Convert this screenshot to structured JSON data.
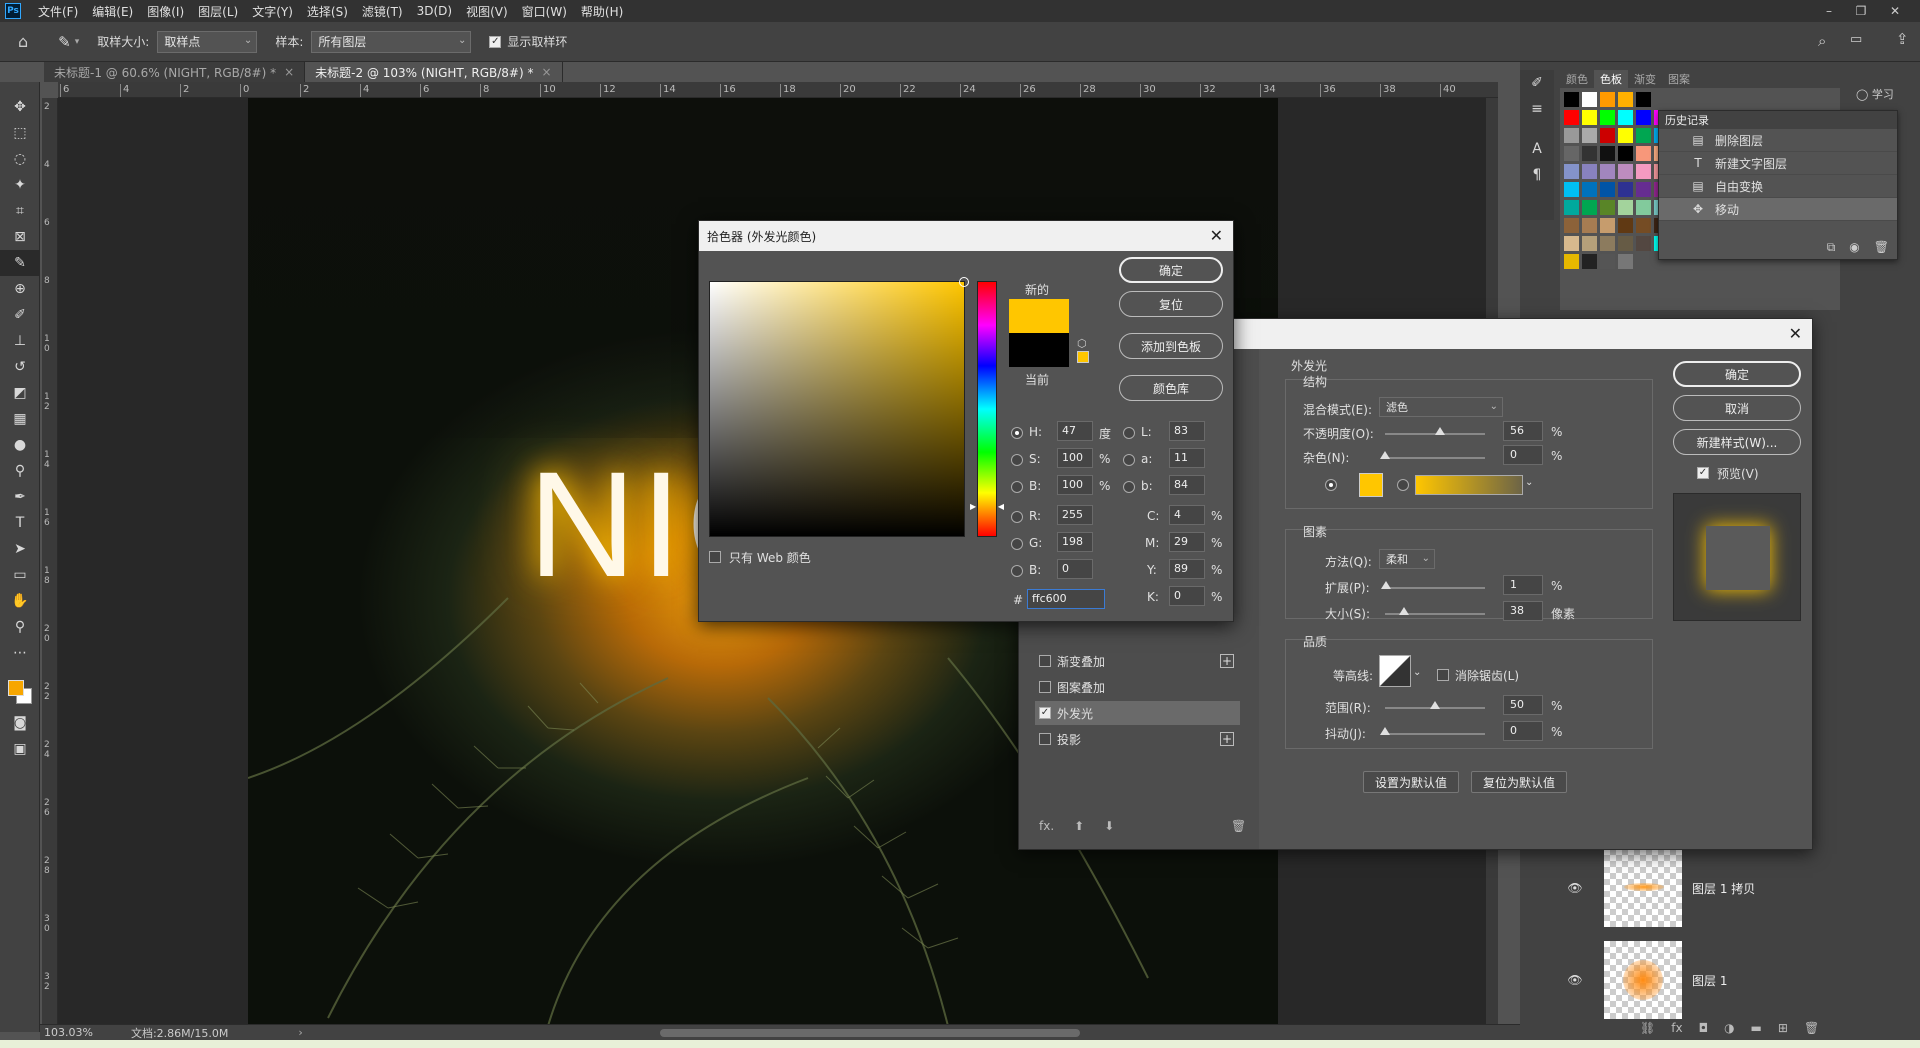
{
  "menubar": {
    "logo": "Ps",
    "items": [
      "文件(F)",
      "编辑(E)",
      "图像(I)",
      "图层(L)",
      "文字(Y)",
      "选择(S)",
      "滤镜(T)",
      "3D(D)",
      "视图(V)",
      "窗口(W)",
      "帮助(H)"
    ],
    "minimize": "–",
    "restore": "❐",
    "close": "✕"
  },
  "options": {
    "sample_size_label": "取样大小:",
    "sample_size_value": "取样点",
    "sample_label": "样本:",
    "sample_value": "所有图层",
    "show_ring_label": "显示取样环",
    "show_ring_checked": true
  },
  "tabs": [
    {
      "label": "未标题-1 @ 60.6% (NIGHT, RGB/8#) *",
      "close": "×"
    },
    {
      "label": "未标题-2 @ 103% (NIGHT, RGB/8#) *",
      "close": "×"
    }
  ],
  "ruler": {
    "h_ticks": [
      "6",
      "4",
      "2",
      "0",
      "2",
      "4",
      "6",
      "8",
      "10",
      "12",
      "14",
      "16",
      "18",
      "20",
      "22",
      "24",
      "26",
      "28",
      "30",
      "32",
      "34",
      "36",
      "38",
      "40",
      "42"
    ],
    "v_ticks": [
      "2",
      "4",
      "6",
      "8",
      "1 0",
      "1 2",
      "1 4",
      "1 6",
      "1 8",
      "2 0",
      "2 2",
      "2 4",
      "2 6",
      "2 8",
      "3 0",
      "3 2"
    ]
  },
  "canvas": {
    "text": "NIG"
  },
  "status": {
    "zoom": "103.03%",
    "doc": "文档:2.86M/15.0M"
  },
  "swatches_panel": {
    "tabs": [
      "颜色",
      "色板",
      "渐变",
      "图案"
    ],
    "active_tab": "色板",
    "learn_label": "学习"
  },
  "history": {
    "title": "历史记录",
    "items": [
      {
        "icon": "▤",
        "label": "删除图层"
      },
      {
        "icon": "T",
        "label": "新建文字图层"
      },
      {
        "icon": "▤",
        "label": "自由变换"
      },
      {
        "icon": "✥",
        "label": "移动"
      }
    ]
  },
  "layers": [
    {
      "name": "图层 1 拷贝"
    },
    {
      "name": "图层 1"
    }
  ],
  "layer_style": {
    "left_items": [
      {
        "label": "渐变叠加",
        "checked": false,
        "plus": "+"
      },
      {
        "label": "图案叠加",
        "checked": false
      },
      {
        "label": "外发光",
        "checked": true,
        "selected": true
      },
      {
        "label": "投影",
        "checked": false,
        "plus": "+"
      }
    ],
    "fx_label": "fx.",
    "section_title": "外发光",
    "structure_title": "结构",
    "blend_mode_label": "混合模式(E):",
    "blend_mode_value": "滤色",
    "opacity_label": "不透明度(O):",
    "opacity_value": "56",
    "noise_label": "杂色(N):",
    "noise_value": "0",
    "percent": "%",
    "elements_title": "图素",
    "technique_label": "方法(Q):",
    "technique_value": "柔和",
    "spread_label": "扩展(P):",
    "spread_value": "1",
    "size_label": "大小(S):",
    "size_value": "38",
    "px_unit": "像素",
    "quality_title": "品质",
    "contour_label": "等高线:",
    "antialias_label": "消除锯齿(L)",
    "range_label": "范围(R):",
    "range_value": "50",
    "jitter_label": "抖动(J):",
    "jitter_value": "0",
    "set_default": "设置为默认值",
    "reset_default": "复位为默认值",
    "ok": "确定",
    "cancel": "取消",
    "new_style": "新建样式(W)...",
    "preview_label": "预览(V)",
    "glow_color": "#ffc600"
  },
  "color_picker": {
    "title": "拾色器 (外发光颜色)",
    "ok": "确定",
    "reset": "复位",
    "add_swatch": "添加到色板",
    "color_library": "颜色库",
    "new_label": "新的",
    "current_label": "当前",
    "web_only_label": "只有 Web 颜色",
    "H_label": "H:",
    "H": "47",
    "H_unit": "度",
    "S_label": "S:",
    "S": "100",
    "S_unit": "%",
    "B_label": "B:",
    "B": "100",
    "B_unit": "%",
    "R_label": "R:",
    "R": "255",
    "G_label": "G:",
    "G": "198",
    "Bl_label": "B:",
    "Bl": "0",
    "L_label": "L:",
    "L": "83",
    "a_label": "a:",
    "a": "11",
    "b_label": "b:",
    "b": "84",
    "C_label": "C:",
    "C": "4",
    "M_label": "M:",
    "M": "29",
    "Y_label": "Y:",
    "Y": "89",
    "K_label": "K:",
    "K": "0",
    "pct": "%",
    "hash": "#",
    "hex": "ffc600",
    "new_color": "#ffc600",
    "current_color": "#000000"
  }
}
